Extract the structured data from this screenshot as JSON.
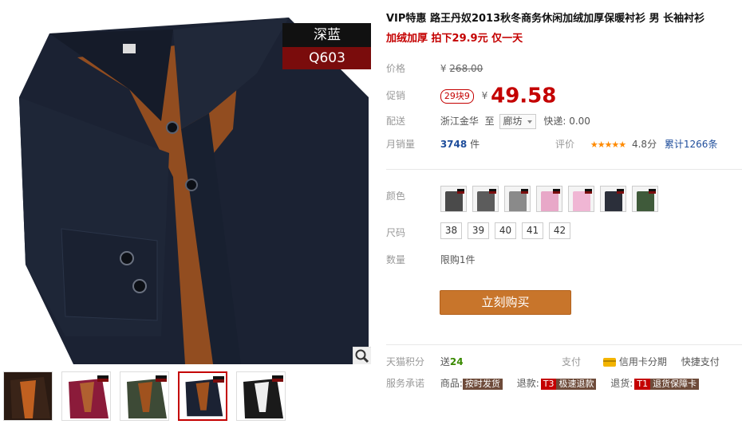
{
  "gallery": {
    "color_tag_name": "深蓝",
    "color_tag_code": "Q603",
    "zoom_icon": "magnifier-icon",
    "thumbnails": [
      {
        "color": "#3a2418",
        "active": false
      },
      {
        "color": "#8b1b3a",
        "active": false
      },
      {
        "color": "#3d4a36",
        "active": false
      },
      {
        "color": "#1b2233",
        "active": true
      },
      {
        "color": "#1a1a1a",
        "active": false
      }
    ]
  },
  "product": {
    "title": "VIP特惠 路王丹奴2013秋冬商务休闲加绒加厚保暖衬衫 男 长袖衬衫",
    "subtitle": "加绒加厚 拍下29.9元 仅一天"
  },
  "price": {
    "label": "价格",
    "currency": "¥",
    "original": "268.00"
  },
  "promo": {
    "label": "促销",
    "badge": "29块9",
    "currency": "¥",
    "value": "49.58"
  },
  "shipping": {
    "label": "配送",
    "from": "浙江金华",
    "to_word": "至",
    "destination": "廊坊",
    "express": "快递: 0.00"
  },
  "sales": {
    "label": "月销量",
    "count": "3748",
    "unit": "件",
    "rating_label": "评价",
    "stars": "★★★★★",
    "score": "4.8分",
    "total_reviews": "累计1266条"
  },
  "color": {
    "label": "颜色",
    "swatches": [
      "#4a4a4a",
      "#5c5c5c",
      "#8a8a8a",
      "#e8a8c8",
      "#f0b6d4",
      "#2b2f3a",
      "#3f5a3a"
    ]
  },
  "size": {
    "label": "尺码",
    "options": [
      "38",
      "39",
      "40",
      "41",
      "42"
    ]
  },
  "quantity": {
    "label": "数量",
    "limit": "限购1件"
  },
  "buy_button": "立刻购买",
  "points": {
    "label": "天猫积分",
    "give_word": "送",
    "amount": "24",
    "pay_label": "支付",
    "credit_label": "信用卡分期",
    "quick_pay": "快捷支付"
  },
  "promise": {
    "label": "服务承诺",
    "goods_label": "商品:",
    "goods_tag": "按时发货",
    "refund_label": "退款:",
    "refund_code": "T3",
    "refund_tag": "极速退款",
    "return_label": "退货:",
    "return_code": "T1",
    "return_tag": "退货保障卡"
  },
  "colors": {
    "accent_red": "#c40000",
    "buy_orange": "#c8752b",
    "link_blue": "#1e4d9b",
    "shirt_navy": "#1b2233",
    "fleece_brown": "#a0521e"
  }
}
